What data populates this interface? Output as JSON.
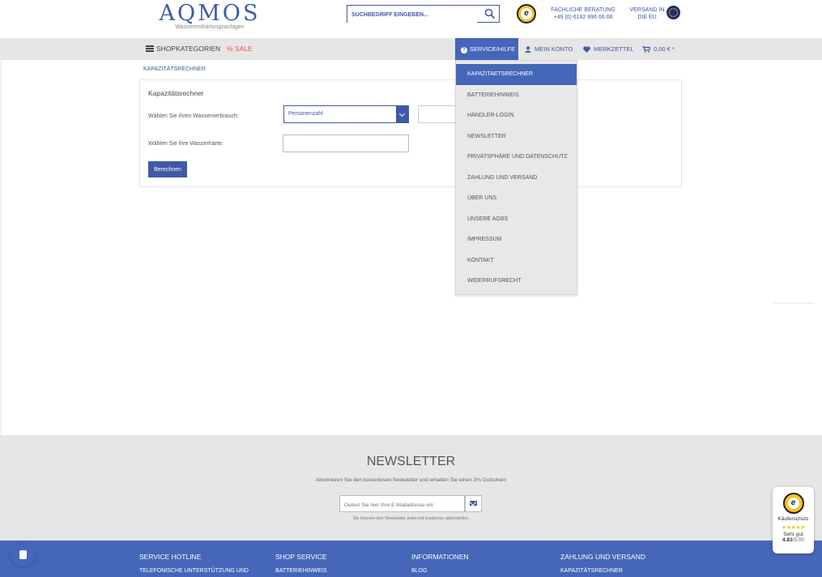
{
  "brand": {
    "logo": "AQMOS",
    "tagline": "Wasserenthärtungsanlagen"
  },
  "search": {
    "placeholder": "SUCHBEGRIFF EINGEBEN..."
  },
  "header": {
    "consult_line1": "FACHLICHE BERATUNG",
    "consult_line2": "+49 (0) 6182 896 66 66",
    "shipping_line1": "VERSAND IN",
    "shipping_line2": "DIE EU"
  },
  "nav": {
    "categories": "SHOPKATEGORIEN",
    "sale": "% SALE",
    "service": "SERVICE/HILFE",
    "account": "MEIN KONTO",
    "wishlist": "MERKZETTEL",
    "cart": "0,00 € *"
  },
  "breadcrumb": "KAPAZITÄTSRECHNER",
  "calculator": {
    "title": "Kapazitätsrechner",
    "consumption_label": "Wählen Sie ihren Wasserverbrauch:",
    "consumption_selected": "Personenzahl",
    "hardness_label": "Wählen Sie ihre Wasserhärte:",
    "submit_label": "Berechnen"
  },
  "service_menu": {
    "items": [
      "KAPAZITAETSRECHNER",
      "BATTERIEHINWEIS",
      "HÄNDLER-LOGIN",
      "NEWSLETTER",
      "PRIVATSPHÄRE UND DATENSCHUTZ",
      "ZAHLUNG UND VERSAND",
      "ÜBER UNS",
      "UNSERE AGBS",
      "IMPRESSUM",
      "KONTAKT",
      "WIDERRUFSRECHT"
    ],
    "active_index": 0
  },
  "newsletter": {
    "title": "NEWSLETTER",
    "subtitle": "Abonnieren Sie den kostenlosen Newsletter und erhalten Sie einen 3% Gutschein",
    "email_placeholder": "Geben Sie hier Ihre E-Mailadresse ein",
    "note": "Sie können den Newsletter jederzeit kostenlos abbestellen."
  },
  "footer": {
    "columns": [
      {
        "heading": "SERVICE HOTLINE",
        "first_link": "TELEFONISCHE UNTERSTÜTZUNG UND"
      },
      {
        "heading": "SHOP SERVICE",
        "first_link": "BATTERIEHINWEIS"
      },
      {
        "heading": "INFORMATIONEN",
        "first_link": "BLOG"
      },
      {
        "heading": "ZAHLUNG UND VERSAND",
        "first_link": "KAPAZITÄTSRECHNER"
      }
    ]
  },
  "trusted_shops": {
    "label": "Käuferschutz",
    "stars": "★★★★★",
    "grade": "Sehr gut",
    "score": "4.83",
    "score_max": "/5.00",
    "badge_letter": "e"
  },
  "colors": {
    "brand_blue": "#3f5aa6",
    "nav_active": "#4566b9",
    "sale": "#e8553e",
    "band_gray": "#e6e6e6"
  },
  "icons": [
    "search-icon",
    "trusted-shops-icon",
    "eu-flag-icon",
    "menu-icon",
    "question-icon",
    "user-icon",
    "heart-icon",
    "cart-icon",
    "mail-icon",
    "chat-icon"
  ]
}
